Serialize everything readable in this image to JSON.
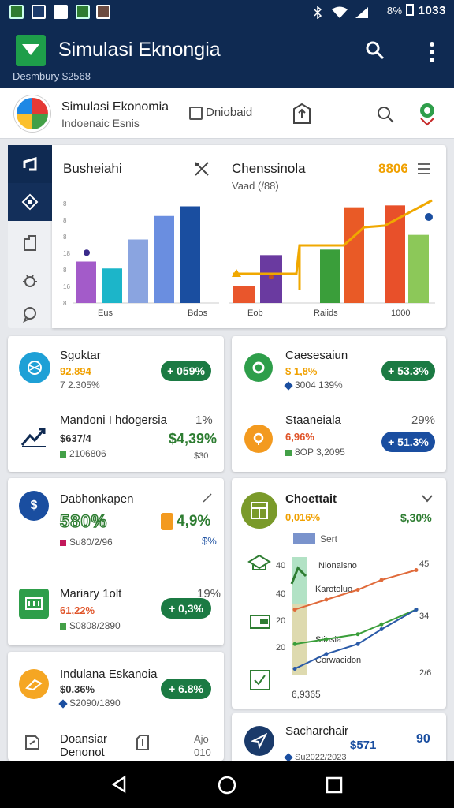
{
  "status": {
    "time": "1033",
    "battery": "8%"
  },
  "app": {
    "title": "Simulasi Eknongia",
    "subtitle": "Desmbury  $2568"
  },
  "profile": {
    "name": "Simulasi Ekonomia",
    "subname": "Indoenaic Esnis",
    "checkbox_label": "Dniobaid"
  },
  "chart_panel": {
    "left_title": "Busheiahi",
    "right_title": "Chenssinola",
    "right_subtitle": "Vaad (/88)",
    "right_value": "8806",
    "left_ticks": [
      "8",
      "16",
      "8",
      "18",
      "8",
      "8",
      "8"
    ],
    "left_labels": [
      "Eus",
      "Bdos"
    ],
    "right_labels": [
      "Eob",
      "Raiids",
      "1000"
    ]
  },
  "chart_data": [
    {
      "type": "bar",
      "categories": [
        "1",
        "2",
        "3",
        "4",
        "5"
      ],
      "values": [
        30,
        25,
        46,
        63,
        70
      ],
      "colors": [
        "#a35bc9",
        "#1cb5c9",
        "#8aa4e0",
        "#6a8ee0",
        "#1a4ea0"
      ],
      "series_marker_value": 33,
      "xlabels": [
        "Eus",
        "Bdos"
      ],
      "ylim": [
        0,
        80
      ]
    },
    {
      "type": "bar",
      "categories": [
        "1",
        "2",
        "3",
        "4",
        "5",
        "6",
        "7"
      ],
      "values": [
        8,
        9,
        26,
        29,
        52,
        53,
        37
      ],
      "colors": [
        "#7b3fa8",
        "#e9562c",
        "#6a3aa0",
        "#3a9e3a",
        "#e95a26",
        "#e8502a",
        "#8cc859"
      ],
      "line_values": [
        14,
        14,
        20,
        40,
        41,
        53,
        58
      ],
      "xlabels": [
        "Eob",
        "Raiids",
        "1000"
      ],
      "ylim": [
        0,
        60
      ]
    }
  ],
  "metrics": [
    {
      "name": "Sgoktar",
      "v1": "92.894",
      "v2": "7 2.305%",
      "pill": "+ 059%",
      "pill_color": "#1b7a43",
      "icon": "globe-icon",
      "icon_color": "#1ea0d6"
    },
    {
      "name": "Caesesaiun",
      "v1": "$ 1,8%",
      "v2": "3004 139% ",
      "pill": "+ 53.3%",
      "pill_color": "#1b7a43",
      "icon": "leaf-icon",
      "icon_color": "#2e9e4a"
    },
    {
      "name": "Mandoni I hdogersia",
      "v1": "$637/4",
      "v2": "2106806",
      "right": "1%",
      "pill_text": "$4,39%",
      "icon": "growth-chart-icon",
      "icon_color": "#0f2a52"
    },
    {
      "name": "Staaneiala",
      "v1": "6,96%",
      "v2": "8OP 3,2095",
      "right": "29%",
      "pill": "+ 51.3%",
      "pill_color": "#1a4ea0",
      "icon": "bulb-icon",
      "icon_color": "#f39a1f"
    },
    {
      "name": "Dabhonkapen",
      "v1": "580%",
      "v2": "Su80/2/96",
      "right": "4,9%",
      "right2": "$%",
      "icon": "dollar-icon",
      "icon_color": "#1a4ea0"
    },
    {
      "name": "Choettait",
      "v1": "0,016%",
      "right": "$,30%",
      "icon": "calculator-icon",
      "icon_color": "#7a9a2a"
    },
    {
      "name": "Mariary 1olt",
      "v1": "61,22%",
      "v2": "S0808/2890",
      "right": "19%",
      "pill": "+ 0,3%",
      "pill_color": "#1b7a43",
      "icon": "money-icon",
      "icon_color": "#2e9e4a"
    },
    {
      "name": "Indulana Eskanoia",
      "v1": "$0.36%",
      "v2": "S2090/1890",
      "pill": "+ 6.8%",
      "pill_color": "#1b7a43",
      "icon": "coins-icon",
      "icon_color": "#f5a623"
    },
    {
      "name": "Doansiar Denonot",
      "right": "Ajo 010",
      "icon": "doc-icon"
    },
    {
      "name": "Sacharchair",
      "v1": "$571",
      "v2": "Su2022/2023",
      "right": "90",
      "icon": "send-icon",
      "icon_color": "#1a3a6a"
    }
  ],
  "line_chart": {
    "legend": "Sert",
    "ticks_left": [
      "40",
      "40",
      "20",
      "20"
    ],
    "ticks_right": [
      "45",
      "34",
      "2/6"
    ],
    "labels": [
      "Nionaisno",
      "Karotoluo",
      "Stiosia",
      "Corwacidon"
    ],
    "footer": "6,9365",
    "series_lines": [
      {
        "name": "orange",
        "values": [
          28,
          32,
          36,
          40,
          44
        ],
        "color": "#e06a3a"
      },
      {
        "name": "green",
        "values": [
          14,
          16,
          18,
          22,
          28
        ],
        "color": "#3a9e3a"
      },
      {
        "name": "blue",
        "values": [
          4,
          10,
          14,
          20,
          28
        ],
        "color": "#2a5aa8"
      }
    ]
  }
}
